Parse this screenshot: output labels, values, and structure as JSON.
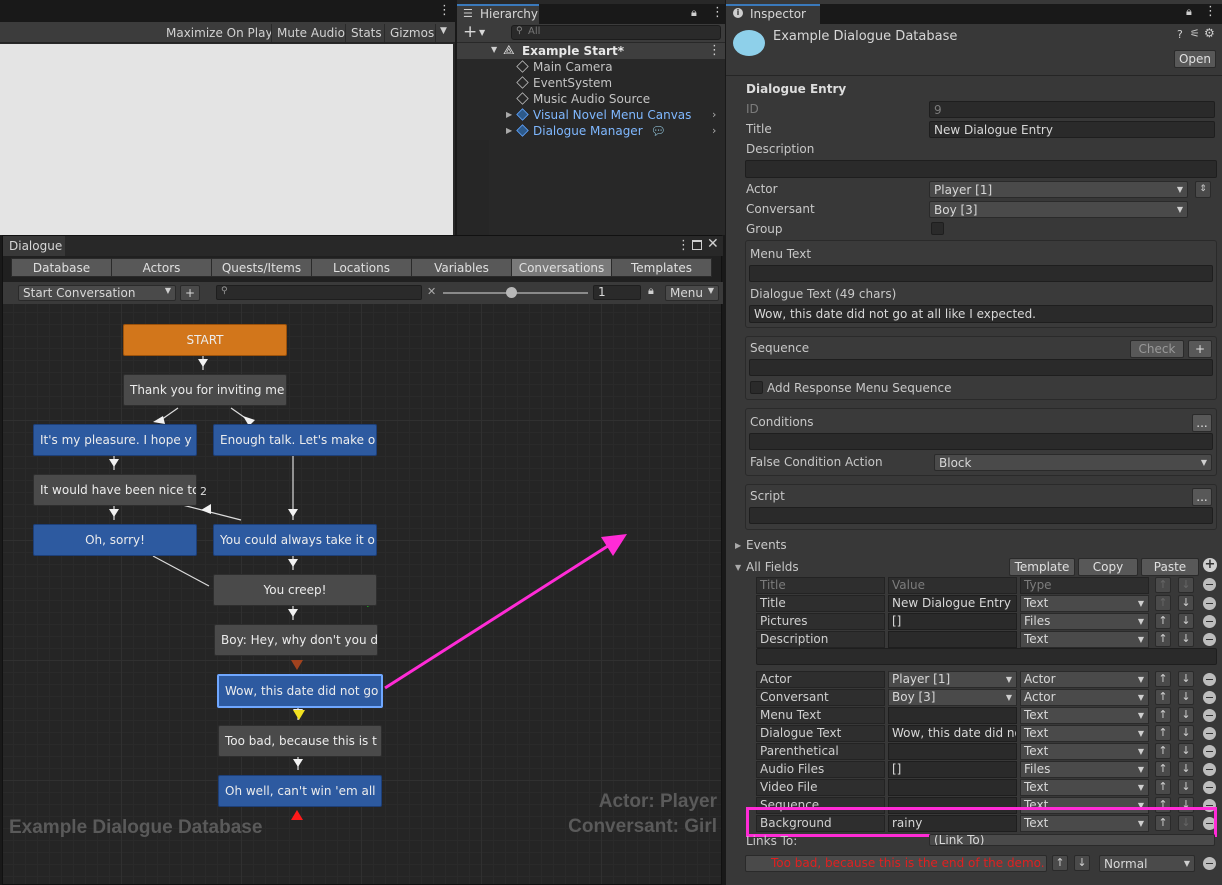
{
  "game_toolbar": {
    "maximize": "Maximize On Play",
    "mute": "Mute Audio",
    "stats": "Stats",
    "gizmos": "Gizmos"
  },
  "hierarchy": {
    "tab": "Hierarchy",
    "search_placeholder": "All",
    "scene": "Example Start*",
    "items": [
      {
        "label": "Main Camera",
        "prefab": false
      },
      {
        "label": "EventSystem",
        "prefab": false
      },
      {
        "label": "Music Audio Source",
        "prefab": false
      },
      {
        "label": "Visual Novel Menu Canvas",
        "prefab": true
      },
      {
        "label": "Dialogue Manager",
        "prefab": true
      }
    ]
  },
  "dialogue_editor": {
    "title": "Dialogue",
    "tabs": [
      "Database",
      "Actors",
      "Quests/Items",
      "Locations",
      "Variables",
      "Conversations",
      "Templates"
    ],
    "selected_tab": "Conversations",
    "conversation": "Start Conversation",
    "zoom": "1",
    "menu": "Menu",
    "nodes": [
      {
        "id": "start",
        "text": "START"
      },
      {
        "id": "n1",
        "text": "Thank you for inviting me"
      },
      {
        "id": "n2",
        "text": "It's my pleasure. I hope y"
      },
      {
        "id": "n3",
        "text": "Enough talk. Let's make ou"
      },
      {
        "id": "n4",
        "text": "It would have been nice to"
      },
      {
        "id": "n5",
        "text": "Oh, sorry!"
      },
      {
        "id": "n6",
        "text": "You could always take it o"
      },
      {
        "id": "n7",
        "text": "You creep!"
      },
      {
        "id": "n8",
        "text": "Boy: Hey, why don't you di"
      },
      {
        "id": "n9",
        "text": "Wow, this date did not go"
      },
      {
        "id": "n10",
        "text": "Too bad, because this is t"
      },
      {
        "id": "n11",
        "text": "Oh well, can't win 'em all"
      }
    ],
    "link_badge": "2",
    "watermark": "Example Dialogue Database",
    "actor_overlay": "Actor: Player",
    "conversant_overlay": "Conversant: Girl"
  },
  "inspector": {
    "tab": "Inspector",
    "header_title": "Example Dialogue Database",
    "open_button": "Open",
    "section": "Dialogue Entry",
    "id_label": "ID",
    "id_value": "9",
    "title_label": "Title",
    "title_value": "New Dialogue Entry",
    "description_label": "Description",
    "actor_label": "Actor",
    "actor_value": "Player [1]",
    "conversant_label": "Conversant",
    "conversant_value": "Boy [3]",
    "group_label": "Group",
    "menu_text_label": "Menu Text",
    "dialogue_text_label": "Dialogue Text (49 chars)",
    "dialogue_text_value": "Wow, this date did not go at all like I expected.",
    "sequence_label": "Sequence",
    "check_button": "Check",
    "add_response_label": "Add Response Menu Sequence",
    "conditions_label": "Conditions",
    "false_condition_label": "False Condition Action",
    "false_condition_value": "Block",
    "script_label": "Script",
    "events_label": "Events",
    "all_fields_label": "All Fields",
    "template_button": "Template",
    "copy_button": "Copy",
    "paste_button": "Paste",
    "col_title": "Title",
    "col_value": "Value",
    "col_type": "Type",
    "fields": [
      {
        "title": "Title",
        "value": "New Dialogue Entry",
        "type": "Text",
        "value_dd": false
      },
      {
        "title": "Pictures",
        "value": "[]",
        "type": "Files",
        "value_dd": false
      },
      {
        "title": "Description",
        "value": "",
        "type": "Text",
        "value_dd": false
      },
      {
        "title": "Actor",
        "value": "Player [1]",
        "type": "Actor",
        "value_dd": true
      },
      {
        "title": "Conversant",
        "value": "Boy [3]",
        "type": "Actor",
        "value_dd": true
      },
      {
        "title": "Menu Text",
        "value": "",
        "type": "Text",
        "value_dd": false
      },
      {
        "title": "Dialogue Text",
        "value": "Wow, this date did not",
        "type": "Text",
        "value_dd": false
      },
      {
        "title": "Parenthetical",
        "value": "",
        "type": "Text",
        "value_dd": false
      },
      {
        "title": "Audio Files",
        "value": "[]",
        "type": "Files",
        "value_dd": false
      },
      {
        "title": "Video File",
        "value": "",
        "type": "Text",
        "value_dd": false
      },
      {
        "title": "Sequence",
        "value": "",
        "type": "Text",
        "value_dd": false
      },
      {
        "title": "Background",
        "value": "rainy",
        "type": "Text",
        "value_dd": false
      }
    ],
    "links_to_label": "Links To:",
    "links_to_value": "(Link To)",
    "link_entry": "Too bad, because this is the end of the demo.",
    "link_priority": "Normal"
  },
  "colors": {
    "highlight": "#ff2bd6",
    "accent_blue": "#3a79bb",
    "node_blue": "#2d5aa0",
    "node_orange": "#d2761b",
    "warning_red": "#e02020"
  }
}
